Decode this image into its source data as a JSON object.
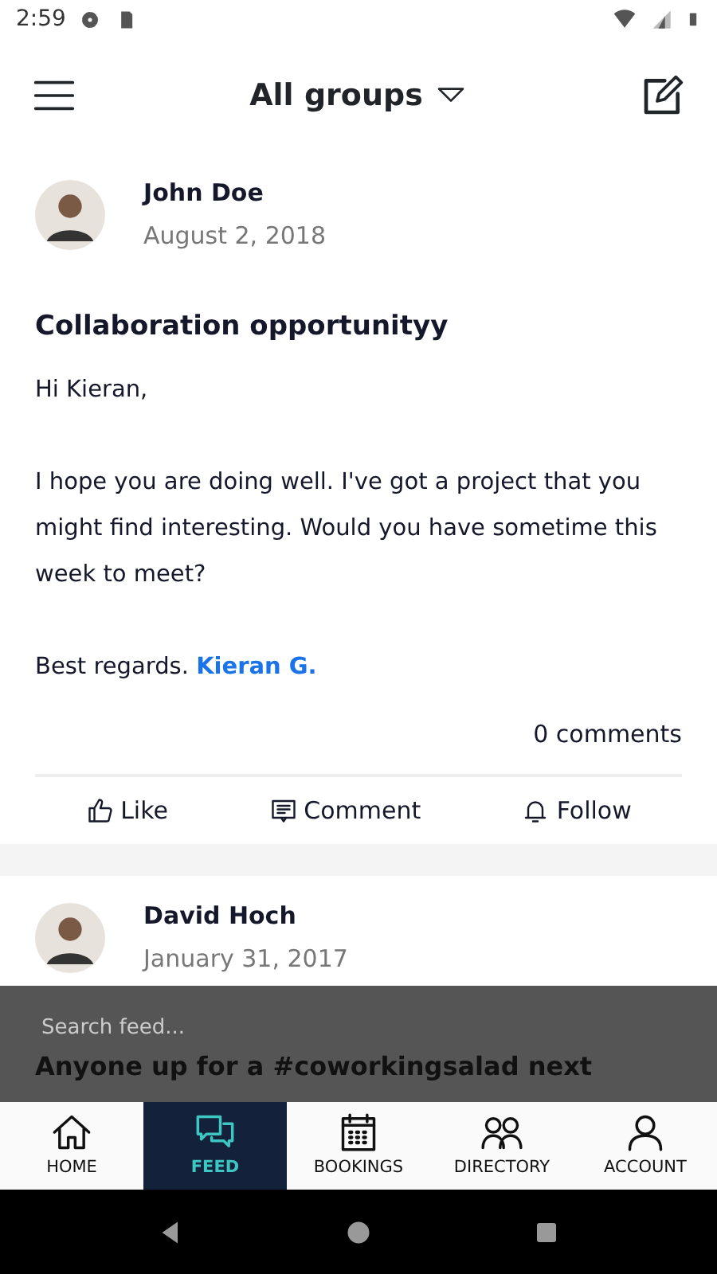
{
  "status_bar": {
    "time": "2:59"
  },
  "header": {
    "title": "All groups"
  },
  "posts": [
    {
      "author": "John Doe",
      "date": "August 2, 2018",
      "title": "Collaboration opportunityy",
      "greeting": "Hi Kieran,",
      "body": "I hope you are doing well. I've got a project that you might find interesting. Would you have sometime this week to meet?",
      "signoff": "Best regards.",
      "mention": "Kieran G.",
      "comments": "0 comments",
      "actions": [
        {
          "kind": "like",
          "label": "Like"
        },
        {
          "kind": "comment",
          "label": "Comment"
        },
        {
          "kind": "follow",
          "label": "Follow"
        }
      ]
    },
    {
      "author": "David Hoch",
      "date": "January 31, 2017",
      "title": "Anyone up for a #coworkingsalad next"
    }
  ],
  "search": {
    "placeholder": "Search feed..."
  },
  "bottom_nav": [
    {
      "kind": "home",
      "label": "HOME",
      "selected": false
    },
    {
      "kind": "feed",
      "label": "FEED",
      "selected": true
    },
    {
      "kind": "bookings",
      "label": "BOOKINGS",
      "selected": false
    },
    {
      "kind": "directory",
      "label": "DIRECTORY",
      "selected": false
    },
    {
      "kind": "account",
      "label": "ACCOUNT",
      "selected": false
    }
  ]
}
